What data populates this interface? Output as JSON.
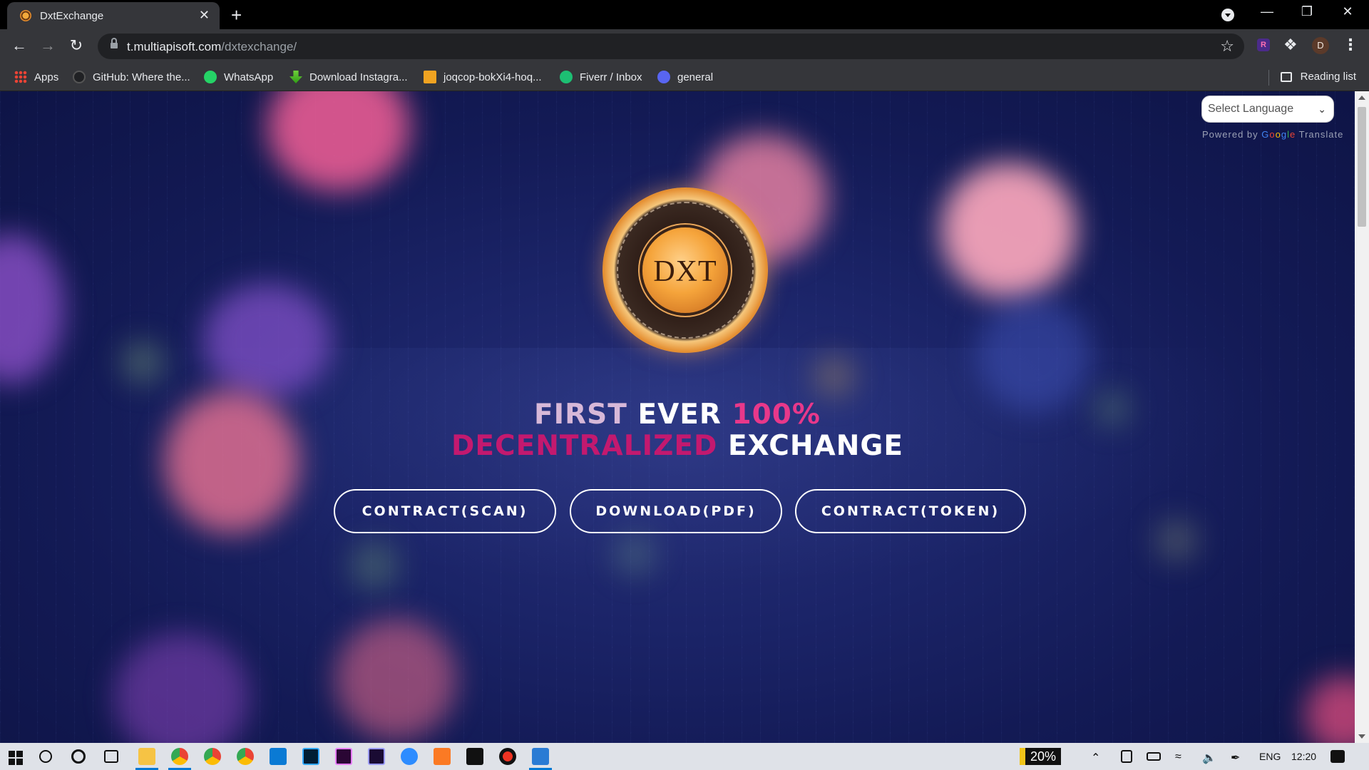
{
  "browser": {
    "tab_title": "DxtExchange",
    "tab_close": "✕",
    "new_tab": "+",
    "url_host": "t.multiapisoft.com",
    "url_path": "/dxtexchange/",
    "profile_initial": "D",
    "extension_label": "R",
    "window_controls": {
      "minimize": "—",
      "restore": "❐",
      "close": "✕"
    }
  },
  "bookmarks": [
    {
      "label": "Apps",
      "icon": "apps-grid-icon"
    },
    {
      "label": "GitHub: Where the...",
      "icon": "github-icon"
    },
    {
      "label": "WhatsApp",
      "icon": "whatsapp-icon"
    },
    {
      "label": "Download Instagra...",
      "icon": "download-arrow-icon"
    },
    {
      "label": "joqcop-bokXi4-hoq...",
      "icon": "package-box-icon"
    },
    {
      "label": "Fiverr / Inbox",
      "icon": "fiverr-icon"
    },
    {
      "label": "general",
      "icon": "discord-icon"
    }
  ],
  "reading_list": "Reading list",
  "translate": {
    "select_label": "Select Language",
    "powered_by": "Powered by",
    "google": [
      "G",
      "o",
      "o",
      "g",
      "l",
      "e"
    ],
    "translate_word": "Translate"
  },
  "hero": {
    "coin_text": "DXT",
    "line1": {
      "a": "FIRST ",
      "b": "EVER ",
      "c": "100%"
    },
    "line2": {
      "a": "DECENTRALIZED",
      "b": " EXCHANGE"
    },
    "buttons": [
      "CONTRACT(SCAN)",
      "DOWNLOAD(PDF)",
      "CONTRACT(TOKEN)"
    ]
  },
  "taskbar": {
    "battery_percent": "20%",
    "language": "ENG",
    "time": "12:20"
  },
  "colors": {
    "accent_pink": "#e8388a",
    "accent_magenta": "#c3196f",
    "page_background": "#1b2468",
    "browser_chrome": "#35363a"
  }
}
